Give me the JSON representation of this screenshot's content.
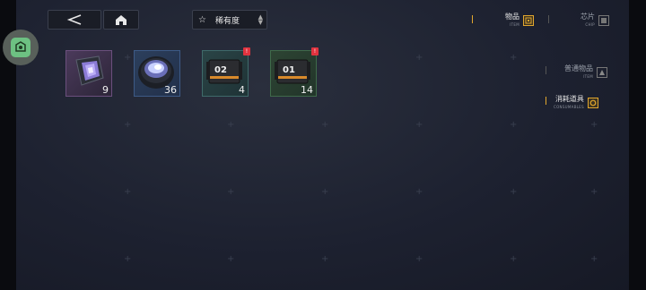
{
  "toolbar": {
    "sort_label": "稀有度",
    "sort_star": "☆"
  },
  "categories": [
    {
      "label": "物品",
      "sub": "ITEM",
      "active": true
    },
    {
      "label": "芯片",
      "sub": "CHIP",
      "active": false
    }
  ],
  "subcategories": [
    {
      "label": "普通物品",
      "sub": "ITEM",
      "active": false
    },
    {
      "label": "消耗道具",
      "sub": "CONSUMABLES",
      "active": true
    }
  ],
  "items": [
    {
      "name": "crystal",
      "count": "9",
      "rarity_color": "#6b4f7d",
      "new": false
    },
    {
      "name": "lens",
      "count": "36",
      "rarity_color": "#3d5a86",
      "new": false
    },
    {
      "name": "crate-02",
      "count": "4",
      "label": "02",
      "rarity_color": "#3f6a6a",
      "new": true
    },
    {
      "name": "crate-01",
      "count": "14",
      "label": "01",
      "rarity_color": "#3f6a4a",
      "new": true
    }
  ],
  "badges": {
    "new_mark": "!"
  },
  "colors": {
    "accent": "#e2a72e",
    "badge": "#e0333f"
  }
}
